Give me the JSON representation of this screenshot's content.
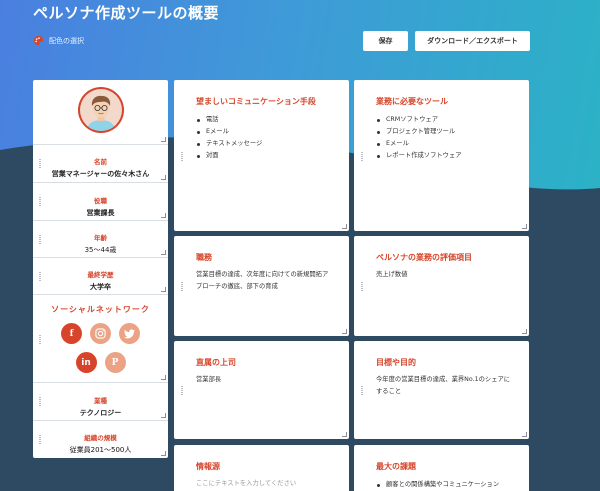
{
  "header": {
    "title": "ペルソナ作成ツールの概要",
    "color_select_label": "配色の選択",
    "save_label": "保存",
    "export_label": "ダウンロード／エクスポート"
  },
  "sidebar": {
    "name": {
      "label": "名前",
      "value": "営業マネージャーの佐々木さん"
    },
    "position": {
      "label": "役職",
      "value": "営業課長"
    },
    "age": {
      "label": "年齢",
      "value": "35〜44歳"
    },
    "education": {
      "label": "最終学歴",
      "value": "大学卒"
    },
    "social": {
      "title": "ソーシャルネットワーク",
      "icons": [
        "facebook-icon",
        "instagram-icon",
        "twitter-icon",
        "linkedin-icon",
        "pinterest-icon"
      ],
      "glyphs": {
        "facebook": "f",
        "linkedin": "in",
        "pinterest": "P"
      }
    },
    "industry": {
      "label": "業種",
      "value": "テクノロジー"
    },
    "org_size": {
      "label": "組織の規模",
      "value": "従業員201〜500人"
    }
  },
  "cards": {
    "communication": {
      "title": "望ましいコミュニケーション手段",
      "items": [
        "電話",
        "Eメール",
        "テキストメッセージ",
        "対面"
      ]
    },
    "tools": {
      "title": "業務に必要なツール",
      "items": [
        "CRMソフトウェア",
        "プロジェクト管理ツール",
        "Eメール",
        "レポート作成ソフトウェア"
      ]
    },
    "duties": {
      "title": "職務",
      "text": "営業目標の達成、次年度に向けての新規開拓アプローチの徹底、部下の育成"
    },
    "evaluation": {
      "title": "ペルソナの業務の評価項目",
      "text": "売上げ数値"
    },
    "boss": {
      "title": "直属の上司",
      "text": "営業部長"
    },
    "goals": {
      "title": "目標や目的",
      "text": "今年度の営業目標の達成、業界No.1のシェアにすること"
    },
    "info_source": {
      "title": "情報源",
      "placeholder": "ここにテキストを入力してください"
    },
    "challenges": {
      "title": "最大の課題",
      "items": [
        "顧客との関係構築やコミュニケーション"
      ]
    }
  },
  "colors": {
    "accent": "#d6452b",
    "accent_light": "#eca285",
    "bg_dark": "#2e4a62",
    "bg_blue": "#4a7fe0",
    "bg_teal": "#2bb2c6"
  }
}
